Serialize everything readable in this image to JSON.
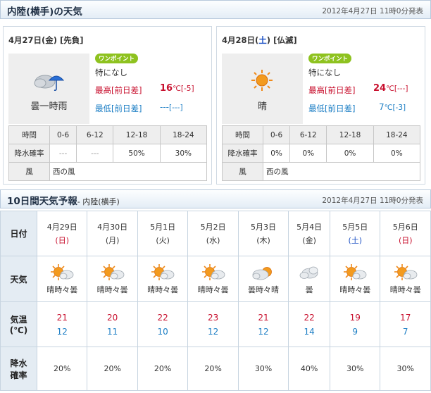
{
  "top_header": {
    "title": "内陸(横手)の天気",
    "updated": "2012年4月27日 11時0分発表"
  },
  "today": {
    "date_main": "4月27日",
    "weekday": "(金)",
    "rokuyo": "[先負]",
    "weather_icon": "cloud-with-rain-umbrella-icon",
    "weather": "曇一時雨",
    "badge": "ワンポイント",
    "note": "特になし",
    "max_label": "最高[前日差]",
    "max_temp": "16",
    "max_unit": "℃",
    "max_diff": "[-5]",
    "min_label": "最低[前日差]",
    "min_temp": "---",
    "min_diff": "[---]",
    "rain_table": {
      "time_label": "時間",
      "periods": [
        "0-6",
        "6-12",
        "12-18",
        "18-24"
      ],
      "pop_label": "降水確率",
      "pop": [
        "---",
        "---",
        "50%",
        "30%"
      ],
      "wind_label": "風",
      "wind": "西の風"
    }
  },
  "tomorrow": {
    "date_main": "4月28日",
    "date_open": "(",
    "weekday_char": "土",
    "date_close": ")",
    "rokuyo": "[仏滅]",
    "weather_icon": "sun-icon",
    "weather": "晴",
    "badge": "ワンポイント",
    "note": "特になし",
    "max_label": "最高[前日差]",
    "max_temp": "24",
    "max_unit": "℃",
    "max_diff": "[---]",
    "min_label": "最低[前日差]",
    "min_temp": "7",
    "min_unit": "℃",
    "min_diff": "[-3]",
    "rain_table": {
      "time_label": "時間",
      "periods": [
        "0-6",
        "6-12",
        "12-18",
        "18-24"
      ],
      "pop_label": "降水確率",
      "pop": [
        "0%",
        "0%",
        "0%",
        "0%"
      ],
      "wind_label": "風",
      "wind": "西の風"
    }
  },
  "ten_day_header": {
    "title": "10日間天気予報",
    "subtitle": "- 内陸(横手)",
    "updated": "2012年4月27日 11時0分発表"
  },
  "ten_day": {
    "row_labels": {
      "date": "日付",
      "weather": "天気",
      "temp_1": "気温",
      "temp_2": "(℃)",
      "pop_1": "降水",
      "pop_2": "確率"
    },
    "days": [
      {
        "date": "4月29日",
        "weekday": "(日)",
        "icon": "sun-and-cloud-icon",
        "weather": "晴時々曇",
        "high": "21",
        "low": "12",
        "pop": "20%"
      },
      {
        "date": "4月30日",
        "weekday": "(月)",
        "icon": "sun-and-cloud-icon",
        "weather": "晴時々曇",
        "high": "20",
        "low": "11",
        "pop": "20%"
      },
      {
        "date": "5月1日",
        "weekday": "(火)",
        "icon": "sun-and-cloud-icon",
        "weather": "晴時々曇",
        "high": "22",
        "low": "10",
        "pop": "20%"
      },
      {
        "date": "5月2日",
        "weekday": "(水)",
        "icon": "sun-and-cloud-icon",
        "weather": "晴時々曇",
        "high": "23",
        "low": "12",
        "pop": "20%"
      },
      {
        "date": "5月3日",
        "weekday": "(木)",
        "icon": "cloud-and-sun-icon",
        "weather": "曇時々晴",
        "high": "21",
        "low": "12",
        "pop": "30%"
      },
      {
        "date": "5月4日",
        "weekday": "(金)",
        "icon": "cloud-icon",
        "weather": "曇",
        "high": "22",
        "low": "14",
        "pop": "40%"
      },
      {
        "date": "5月5日",
        "weekday": "(土)",
        "icon": "sun-and-cloud-icon",
        "weather": "晴時々曇",
        "high": "19",
        "low": "9",
        "pop": "30%"
      },
      {
        "date": "5月6日",
        "weekday": "(日)",
        "icon": "sun-and-cloud-icon",
        "weather": "晴時々曇",
        "high": "17",
        "low": "7",
        "pop": "30%"
      }
    ]
  },
  "colors": {
    "max_red": "#c8102e",
    "min_blue": "#1a7dc4",
    "saturday_blue": "#1a4fc4",
    "badge_green": "#8ec21f",
    "header_bg": "#e4edf6"
  }
}
